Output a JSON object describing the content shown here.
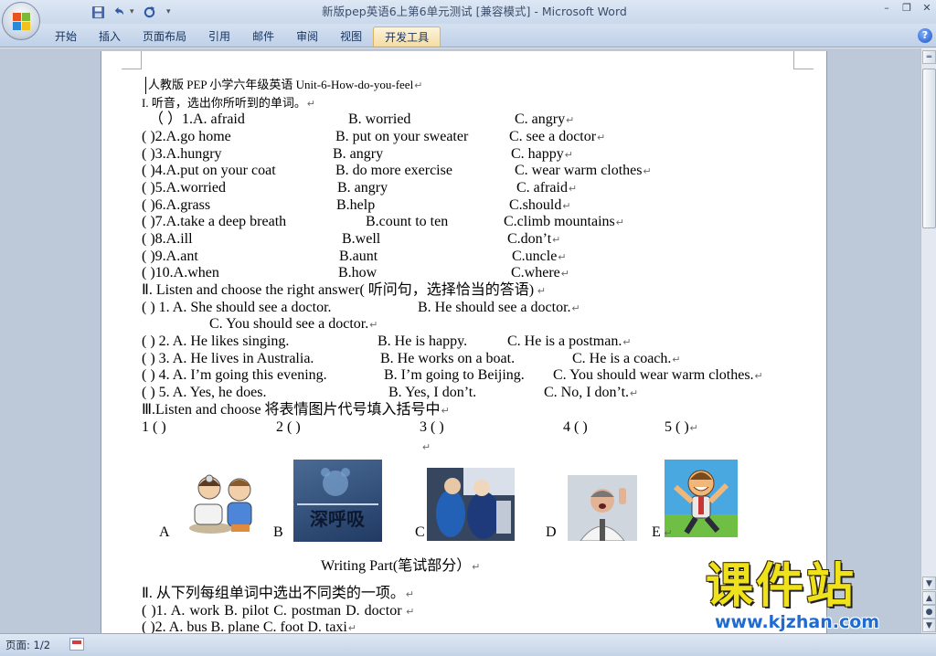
{
  "window": {
    "title": "新版pep英语6上第6单元测试 [兼容模式] - Microsoft Word"
  },
  "quick_access": {
    "save_icon": "save-icon",
    "undo_icon": "undo-icon",
    "redo_icon": "redo-icon"
  },
  "ribbon": {
    "tabs": [
      "开始",
      "插入",
      "页面布局",
      "引用",
      "邮件",
      "审阅",
      "视图",
      "开发工具"
    ],
    "active_tab": "开发工具"
  },
  "document": {
    "lines": [
      "人教版 PEP 小学六年级英语 Unit-6-How-do-you-feel",
      "I.        听音，选出你所听到的单词。",
      "（     ）1.A. afraid",
      "B. worried",
      "C. angry",
      "(       )2.A.go home",
      "B. put on your sweater",
      "C. see a doctor",
      "(       )3.A.hungry",
      "B. angry",
      "C. happy",
      "(       )4.A.put on your coat",
      "B. do more exercise",
      "C. wear warm clothes",
      "(       )5.A.worried",
      "B. angry",
      "C. afraid",
      "(       )6.A.grass",
      "B.help",
      "C.should",
      "(       )7.A.take a deep breath",
      "B.count to ten",
      "C.climb mountains",
      "(       )8.A.ill",
      "B.well",
      "C.don’t",
      "(       )9.A.ant",
      "B.aunt",
      "C.uncle",
      "(       )10.A.when",
      "B.how",
      "C.where",
      "Ⅱ. Listen and choose the right answer( 听问句，选择恰当的答语)",
      "(    ) 1. A. She should see a doctor.",
      "B. He should see a doctor.",
      "C. You should see a doctor.",
      "(    ) 2. A. He likes singing.",
      "B. He is happy.",
      "C. He is a postman.",
      "(    ) 3. A. He lives in Australia.",
      "B. He works on a boat.",
      "C. He is a coach.",
      "(    ) 4. A. I’m going this evening.",
      "B. I’m going to Beijing.",
      "C. You should wear warm clothes.",
      "(    ) 5. A. Yes, he does.",
      "B. Yes, I don’t.",
      "C. No, I don’t.",
      "Ⅲ.Listen and choose 将表情图片代号填入括号中",
      "1 (      )",
      "2 (      )",
      "3 (      )",
      "4 (      )",
      "5 (      )",
      "A",
      "B",
      "C",
      "D",
      "E",
      "Writing Part(笔试部分）",
      "Ⅱ. 从下列每组单词中选出不同类的一项。",
      "(       )1. A. work    B. pilot    C. postman    D. doctor",
      "(       )2. A. bus    B. plane    C. foot    D. taxi"
    ],
    "picture_icons": [
      "doctor-patient-icon",
      "outdoor-club-logo-icon",
      "skiers-photo-icon",
      "angry-man-photo-icon",
      "happy-cartoon-man-icon"
    ],
    "picture_b_text": "深呼吸"
  },
  "status": {
    "page": "页面: 1/2"
  },
  "watermark": {
    "brand": "课件站",
    "url": "www.kjzhan.com"
  },
  "colors": {
    "title_text": "#3c4e6b",
    "ribbon": "#bfd0e7",
    "workspace": "#bdc8d8",
    "watermark_yellow": "#f0e21a",
    "watermark_blue": "#1f6bd1"
  }
}
